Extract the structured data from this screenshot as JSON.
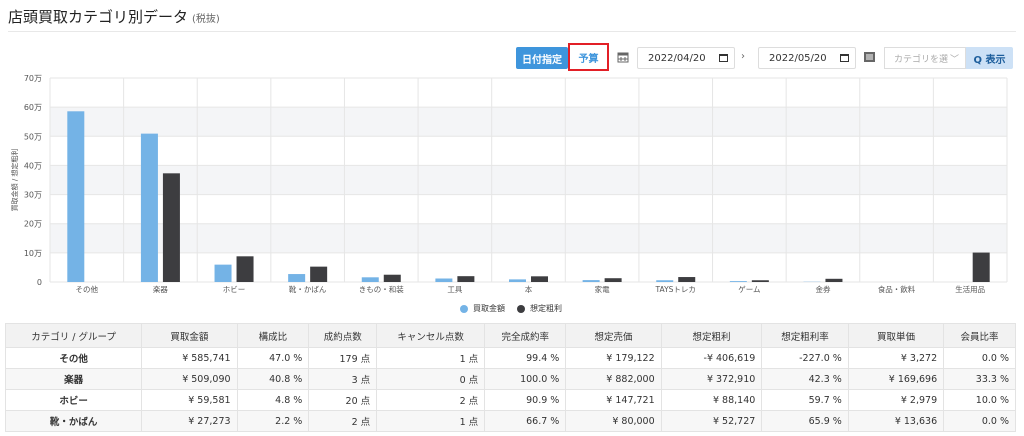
{
  "header": {
    "title": "店頭買取カテゴリ別データ",
    "subtitle": "(税抜)"
  },
  "toolbar": {
    "date_button": "日付指定",
    "budget_button": "予算",
    "date_from": "2022/04/20",
    "date_to": "2022/05/20",
    "range_separator": "›",
    "category_placeholder": "カテゴリを選",
    "category_dropdown": "﹀",
    "show_button": "Q 表示"
  },
  "chart_data": {
    "type": "bar",
    "categories": [
      "その他",
      "楽器",
      "ホビー",
      "靴・かばん",
      "きもの・和装",
      "工具",
      "本",
      "家電",
      "TAYSトレカ",
      "ゲーム",
      "金券",
      "食品・飲料",
      "生活用品"
    ],
    "series": [
      {
        "name": "買取金額",
        "color": "#74b3e6",
        "values": [
          585741,
          509090,
          59581,
          27273,
          16100,
          12000,
          9000,
          6500,
          6000,
          3000,
          800,
          0,
          0
        ]
      },
      {
        "name": "想定粗利",
        "color": "#3d3d40",
        "values": [
          0,
          372910,
          88140,
          52727,
          25000,
          20000,
          19500,
          13000,
          17000,
          6000,
          11000,
          0,
          101000
        ]
      }
    ],
    "y_ticks": [
      "0",
      "10万",
      "20万",
      "30万",
      "40万",
      "50万",
      "60万",
      "70万"
    ],
    "ylim": [
      0,
      700000
    ],
    "ylabel": "買取金額 / 想定粗利",
    "legend_position": "bottom"
  },
  "table": {
    "headers": [
      "カテゴリ / グループ",
      "買取金額",
      "構成比",
      "成約点数",
      "キャンセル点数",
      "完全成約率",
      "想定売価",
      "想定粗利",
      "想定粗利率",
      "買取単価",
      "会員比率"
    ],
    "rows": [
      [
        "その他",
        "¥ 585,741",
        "47.0 %",
        "179 点",
        "1 点",
        "99.4 %",
        "¥ 179,122",
        "-¥ 406,619",
        "-227.0 %",
        "¥ 3,272",
        "0.0 %"
      ],
      [
        "楽器",
        "¥ 509,090",
        "40.8 %",
        "3 点",
        "0 点",
        "100.0 %",
        "¥ 882,000",
        "¥ 372,910",
        "42.3 %",
        "¥ 169,696",
        "33.3 %"
      ],
      [
        "ホビー",
        "¥ 59,581",
        "4.8 %",
        "20 点",
        "2 点",
        "90.9 %",
        "¥ 147,721",
        "¥ 88,140",
        "59.7 %",
        "¥ 2,979",
        "10.0 %"
      ],
      [
        "靴・かばん",
        "¥ 27,273",
        "2.2 %",
        "2 点",
        "1 点",
        "66.7 %",
        "¥ 80,000",
        "¥ 52,727",
        "65.9 %",
        "¥ 13,636",
        "0.0 %"
      ]
    ]
  }
}
